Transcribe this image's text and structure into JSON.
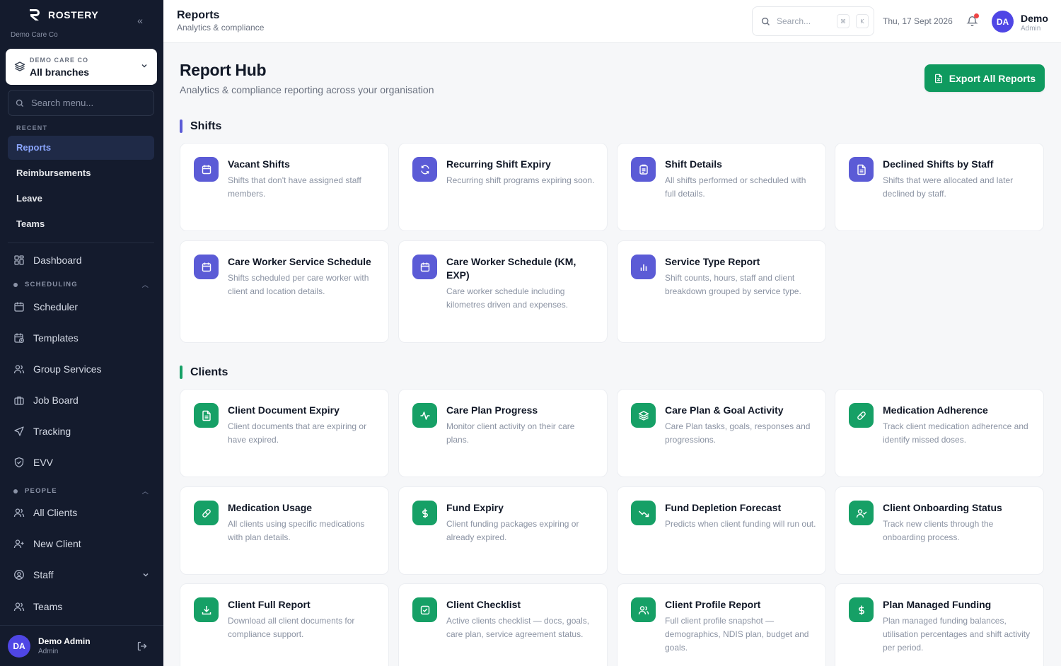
{
  "brand": {
    "name": "ROSTERY",
    "subtitle": "Demo Care Co"
  },
  "branch_selector": {
    "org": "DEMO CARE CO",
    "value": "All branches"
  },
  "sidebar_search": {
    "placeholder": "Search menu..."
  },
  "recent": {
    "label": "RECENT",
    "items": [
      {
        "label": "Reports",
        "active": true
      },
      {
        "label": "Reimbursements"
      },
      {
        "label": "Leave"
      },
      {
        "label": "Teams"
      }
    ]
  },
  "nav": {
    "dashboard": "Dashboard",
    "scheduling_label": "SCHEDULING",
    "scheduling": [
      "Scheduler",
      "Templates",
      "Group Services",
      "Job Board",
      "Tracking",
      "EVV"
    ],
    "people_label": "PEOPLE",
    "people": [
      "All Clients",
      "New Client",
      "Staff",
      "Teams"
    ]
  },
  "sidebar_user": {
    "initials": "DA",
    "name": "Demo Admin",
    "role": "Admin"
  },
  "topbar": {
    "title": "Reports",
    "subtitle": "Analytics & compliance",
    "search_placeholder": "Search...",
    "kbd_cmd": "⌘",
    "kbd_k": "K",
    "date": "Thu, 17 Sept 2026",
    "user_initials": "DA",
    "user_name": "Demo",
    "user_role": "Admin"
  },
  "page": {
    "title": "Report Hub",
    "subtitle": "Analytics & compliance reporting across your organisation",
    "export_label": "Export All Reports"
  },
  "colors": {
    "accent_blue": "#5b5bd6",
    "accent_green": "#16a066",
    "sidebar_bg": "#141b2d"
  },
  "sections": {
    "shifts": {
      "title": "Shifts",
      "cards": [
        {
          "title": "Vacant Shifts",
          "desc": "Shifts that don't have assigned staff members.",
          "icon": "calendar-icon"
        },
        {
          "title": "Recurring Shift Expiry",
          "desc": "Recurring shift programs expiring soon.",
          "icon": "refresh-icon"
        },
        {
          "title": "Shift Details",
          "desc": "All shifts performed or scheduled with full details.",
          "icon": "clipboard-icon"
        },
        {
          "title": "Declined Shifts by Staff",
          "desc": "Shifts that were allocated and later declined by staff.",
          "icon": "document-icon"
        },
        {
          "title": "Care Worker Service Schedule",
          "desc": "Shifts scheduled per care worker with client and location details.",
          "icon": "calendar-icon"
        },
        {
          "title": "Care Worker Schedule (KM, EXP)",
          "desc": "Care worker schedule including kilometres driven and expenses.",
          "icon": "calendar-icon"
        },
        {
          "title": "Service Type Report",
          "desc": "Shift counts, hours, staff and client breakdown grouped by service type.",
          "icon": "bar-chart-icon"
        }
      ]
    },
    "clients": {
      "title": "Clients",
      "cards": [
        {
          "title": "Client Document Expiry",
          "desc": "Client documents that are expiring or have expired.",
          "icon": "document-icon"
        },
        {
          "title": "Care Plan Progress",
          "desc": "Monitor client activity on their care plans.",
          "icon": "activity-icon"
        },
        {
          "title": "Care Plan & Goal Activity",
          "desc": "Care Plan tasks, goals, responses and progressions.",
          "icon": "layers-icon"
        },
        {
          "title": "Medication Adherence",
          "desc": "Track client medication adherence and identify missed doses.",
          "icon": "pill-icon"
        },
        {
          "title": "Medication Usage",
          "desc": "All clients using specific medications with plan details.",
          "icon": "pill-icon"
        },
        {
          "title": "Fund Expiry",
          "desc": "Client funding packages expiring or already expired.",
          "icon": "dollar-icon"
        },
        {
          "title": "Fund Depletion Forecast",
          "desc": "Predicts when client funding will run out.",
          "icon": "trend-down-icon"
        },
        {
          "title": "Client Onboarding Status",
          "desc": "Track new clients through the onboarding process.",
          "icon": "user-check-icon"
        },
        {
          "title": "Client Full Report",
          "desc": "Download all client documents for compliance support.",
          "icon": "download-icon"
        },
        {
          "title": "Client Checklist",
          "desc": "Active clients checklist — docs, goals, care plan, service agreement status.",
          "icon": "checkbox-icon"
        },
        {
          "title": "Client Profile Report",
          "desc": "Full client profile snapshot — demographics, NDIS plan, budget and goals.",
          "icon": "users-icon"
        },
        {
          "title": "Plan Managed Funding",
          "desc": "Plan managed funding balances, utilisation percentages and shift activity per period.",
          "icon": "dollar-icon"
        }
      ]
    }
  }
}
